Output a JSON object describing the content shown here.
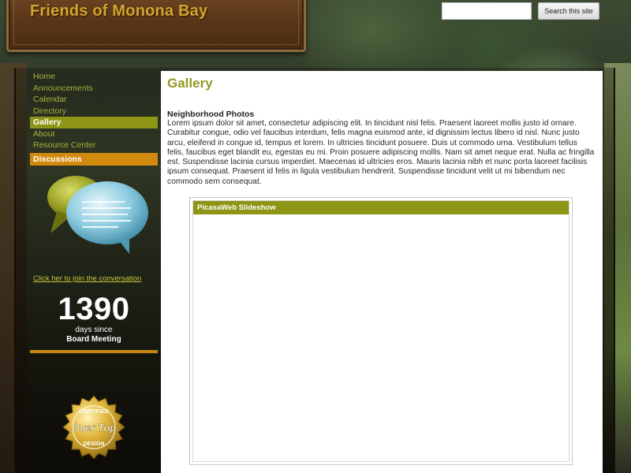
{
  "site": {
    "title": "Friends of Monona Bay"
  },
  "search": {
    "placeholder": "",
    "button_label": "Search this site"
  },
  "sidebar": {
    "nav": [
      {
        "label": "Home",
        "active": false
      },
      {
        "label": "Announcements",
        "active": false
      },
      {
        "label": "Calendar",
        "active": false
      },
      {
        "label": "Directory",
        "active": false
      },
      {
        "label": "Gallery",
        "active": true
      },
      {
        "label": "About",
        "active": false
      },
      {
        "label": "Resource Center",
        "active": false
      }
    ],
    "discussions_label": "Discussions",
    "join_link": "Click her to join the conversation",
    "countdown": {
      "number": "1390",
      "line1": "days since",
      "line2": "Board Meeting"
    },
    "badge_icon": "certified-over-the-top-design-seal"
  },
  "main": {
    "page_title": "Gallery",
    "section_heading": "Neighborhood Photos",
    "body_text": "Lorem ipsum dolor sit amet, consectetur adipiscing elit. In tincidunt nisl felis. Praesent laoreet mollis justo id ornare. Curabitur congue, odio vel faucibus interdum, felis magna euismod ante, id dignissim lectus libero id nisl. Nunc justo arcu, eleifend in congue id, tempus et lorem. In ultricies tincidunt posuere. Duis ut commodo urna. Vestibulum tellus felis, faucibus eget blandit eu, egestas eu mi. Proin posuere adipiscing mollis. Nam sit amet neque erat. Nulla ac fringilla est. Suspendisse lacinia cursus imperdiet. Maecenas id ultricies eros. Mauris lacinia nibh et nunc porta laoreet facilisis ipsum consequat. Praesent id felis in ligula vestibulum hendrerit. Suspendisse tincidunt velit ut mi bibendum nec commodo sem consequat.",
    "slideshow_title": "PicasaWeb Slideshow"
  },
  "colors": {
    "accent_olive": "#8e9414",
    "accent_orange": "#d18a0e",
    "title_gold": "#d4a52c"
  }
}
